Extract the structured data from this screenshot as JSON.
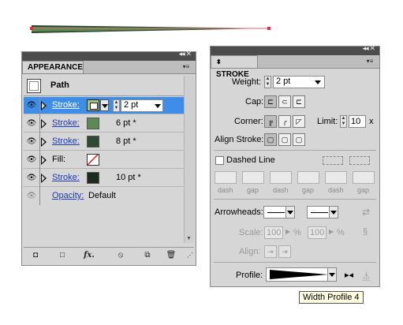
{
  "appearance": {
    "tab_title": "APPEARANCE",
    "header_label": "Path",
    "rows": [
      {
        "label": "Stroke:",
        "value": "2 pt",
        "color": "#a7c47a",
        "selected": true
      },
      {
        "label": "Stroke:",
        "value": "6 pt *",
        "color": "#5c8a55"
      },
      {
        "label": "Stroke:",
        "value": "8 pt *",
        "color": "#2e4a32"
      },
      {
        "label": "Fill:",
        "value": "",
        "color": "none"
      },
      {
        "label": "Stroke:",
        "value": "10 pt *",
        "color": "#1e2a1d"
      }
    ],
    "opacity_label": "Opacity:",
    "opacity_value": "Default",
    "bottom_icons": [
      "new-art-icon",
      "clear-appearance-icon",
      "fx-icon",
      "no-icon",
      "duplicate-icon",
      "trash-icon"
    ],
    "fx_label": "fx."
  },
  "stroke": {
    "tab_title": "STROKE",
    "weight_label": "Weight:",
    "weight_value": "2 pt",
    "cap_label": "Cap:",
    "corner_label": "Corner:",
    "limit_label": "Limit:",
    "limit_value": "10",
    "limit_suffix": "x",
    "align_label": "Align Stroke:",
    "dashed_label": "Dashed Line",
    "dash_labels": [
      "dash",
      "gap",
      "dash",
      "gap",
      "dash",
      "gap"
    ],
    "arrowheads_label": "Arrowheads:",
    "scale_label": "Scale:",
    "scale_value1": "100",
    "scale_value2": "100",
    "percent": "%",
    "align_label2": "Align:",
    "profile_label": "Profile:"
  },
  "tooltip": "Width Profile 4",
  "colors": {
    "selected_row": "#3d8ee8",
    "panel_bg": "#d6d6d6",
    "link": "#1c3bb6",
    "path_stroke": "#2f4a30",
    "anchor": "#e0303a"
  }
}
